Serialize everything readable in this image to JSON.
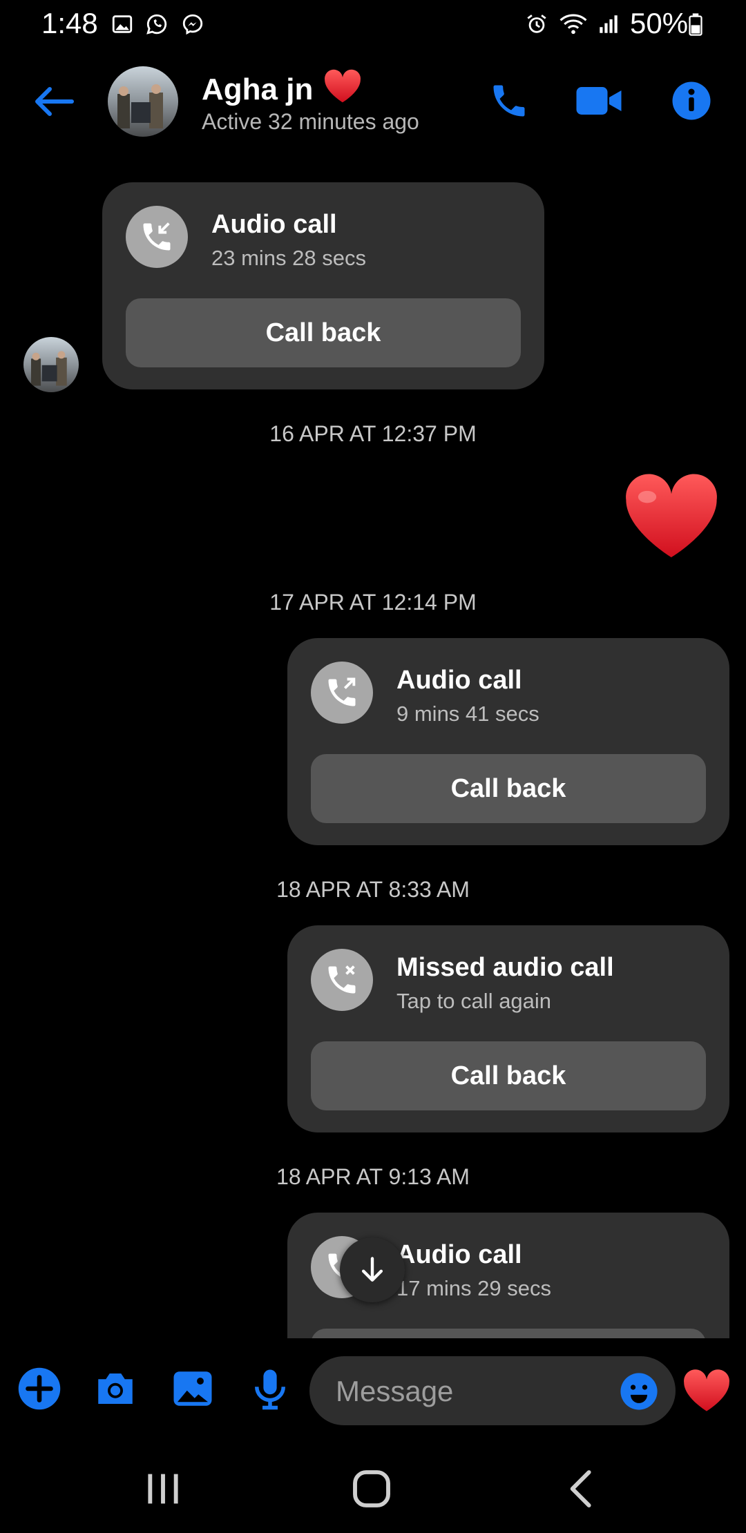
{
  "status_bar": {
    "time": "1:48",
    "battery": "50%",
    "icons": [
      "gallery-icon",
      "whatsapp-icon",
      "messenger-icon",
      "alarm-icon",
      "wifi-icon",
      "signal-icon",
      "battery-icon"
    ]
  },
  "header": {
    "name": "Agha jn",
    "status": "Active 32 minutes ago",
    "icons": [
      "back-arrow-icon",
      "phone-icon",
      "video-camera-icon",
      "info-icon",
      "heart-icon"
    ]
  },
  "messages": [
    {
      "type": "call",
      "direction": "incoming",
      "title": "Audio call",
      "subtitle": "23 mins 28 secs",
      "button": "Call back"
    },
    {
      "type": "timestamp",
      "text": "16 APR AT 12:37 PM"
    },
    {
      "type": "emoji",
      "direction": "outgoing",
      "icon": "heart-icon"
    },
    {
      "type": "timestamp",
      "text": "17 APR AT 12:14 PM"
    },
    {
      "type": "call",
      "direction": "outgoing",
      "title": "Audio call",
      "subtitle": "9 mins 41 secs",
      "button": "Call back"
    },
    {
      "type": "timestamp",
      "text": "18 APR AT 8:33 AM"
    },
    {
      "type": "call",
      "direction": "outgoing",
      "title": "Missed audio call",
      "subtitle": "Tap to call again",
      "button": "Call back"
    },
    {
      "type": "timestamp",
      "text": "18 APR AT 9:13 AM"
    },
    {
      "type": "call",
      "direction": "outgoing",
      "title": "Audio call",
      "subtitle": "17 mins 29 secs"
    }
  ],
  "composer": {
    "placeholder": "Message",
    "icons": [
      "plus-icon",
      "camera-icon",
      "image-icon",
      "microphone-icon",
      "emoji-icon",
      "heart-icon"
    ]
  },
  "colors": {
    "accent": "#1877f2",
    "background": "#000000",
    "bubble": "#303030",
    "button": "#565656",
    "heart": "#e8202e"
  }
}
